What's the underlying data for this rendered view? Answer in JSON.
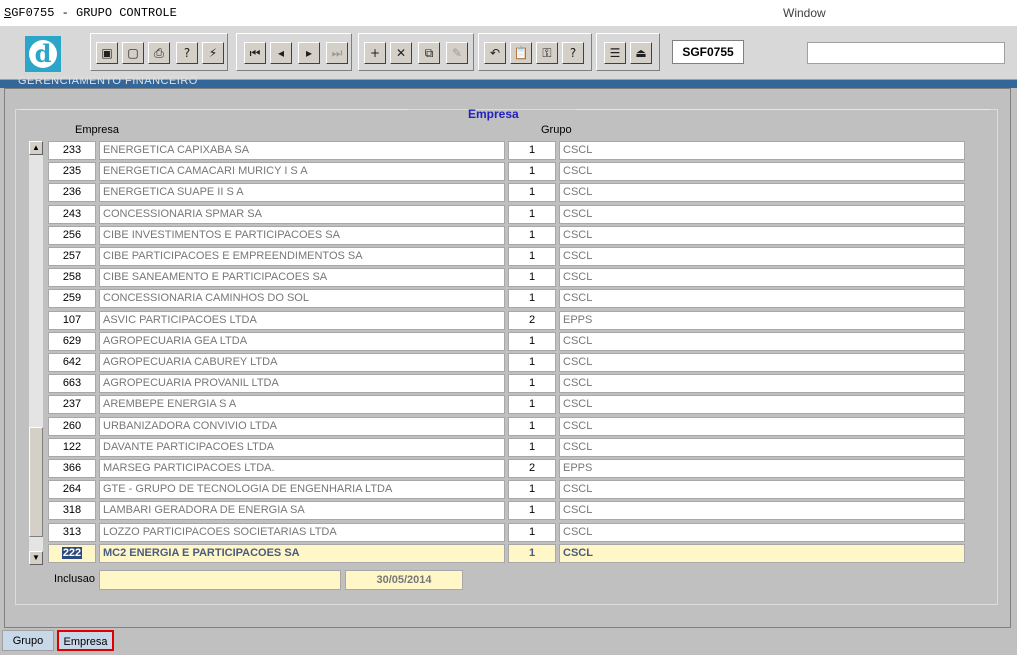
{
  "window": {
    "title_prefix": "S",
    "title_rest": "GF0755 - GRUPO CONTROLE",
    "menu": "Window"
  },
  "toolbar": {
    "form_name": "SGF0755",
    "buttons": [
      {
        "name": "save-icon",
        "glyph": "▣"
      },
      {
        "name": "window-icon",
        "glyph": "▢"
      },
      {
        "name": "print-icon",
        "glyph": "⎙"
      },
      {
        "name": "query-icon",
        "glyph": "?"
      },
      {
        "name": "execute-query-icon",
        "glyph": "⚡"
      },
      {
        "name": "first-record-icon",
        "glyph": "⏮"
      },
      {
        "name": "prev-record-icon",
        "glyph": "◂"
      },
      {
        "name": "next-record-icon",
        "glyph": "▸"
      },
      {
        "name": "last-record-icon",
        "glyph": "⏭"
      },
      {
        "name": "insert-record-icon",
        "glyph": "+"
      },
      {
        "name": "delete-record-icon",
        "glyph": "✕"
      },
      {
        "name": "duplicate-record-icon",
        "glyph": "⧉"
      },
      {
        "name": "edit-icon",
        "glyph": "✎"
      },
      {
        "name": "undo-icon",
        "glyph": "↶"
      },
      {
        "name": "clipboard-icon",
        "glyph": "📋"
      },
      {
        "name": "key-icon",
        "glyph": "⚿"
      },
      {
        "name": "help-icon",
        "glyph": "?"
      },
      {
        "name": "menu-icon",
        "glyph": "☰"
      },
      {
        "name": "exit-icon",
        "glyph": "⏏"
      }
    ]
  },
  "section_title": "Empresa",
  "headers": {
    "empresa": "Empresa",
    "grupo": "Grupo"
  },
  "rows": [
    {
      "code": "233",
      "name": "ENERGETICA CAPIXABA SA",
      "grp": "1",
      "gname": "CSCL"
    },
    {
      "code": "235",
      "name": "ENERGETICA CAMACARI MURICY I S A",
      "grp": "1",
      "gname": "CSCL"
    },
    {
      "code": "236",
      "name": "ENERGETICA SUAPE II S A",
      "grp": "1",
      "gname": "CSCL"
    },
    {
      "code": "243",
      "name": "CONCESSIONARIA SPMAR SA",
      "grp": "1",
      "gname": "CSCL"
    },
    {
      "code": "256",
      "name": "CIBE INVESTIMENTOS E PARTICIPACOES SA",
      "grp": "1",
      "gname": "CSCL"
    },
    {
      "code": "257",
      "name": "CIBE PARTICIPACOES E EMPREENDIMENTOS SA",
      "grp": "1",
      "gname": "CSCL"
    },
    {
      "code": "258",
      "name": "CIBE SANEAMENTO E PARTICIPACOES SA",
      "grp": "1",
      "gname": "CSCL"
    },
    {
      "code": "259",
      "name": "CONCESSIONARIA CAMINHOS DO SOL",
      "grp": "1",
      "gname": "CSCL"
    },
    {
      "code": "107",
      "name": "ASVIC PARTICIPACOES LTDA",
      "grp": "2",
      "gname": "EPPS"
    },
    {
      "code": "629",
      "name": "AGROPECUARIA GEA LTDA",
      "grp": "1",
      "gname": "CSCL"
    },
    {
      "code": "642",
      "name": "AGROPECUARIA CABUREY LTDA",
      "grp": "1",
      "gname": "CSCL"
    },
    {
      "code": "663",
      "name": "AGROPECUARIA PROVANIL LTDA",
      "grp": "1",
      "gname": "CSCL"
    },
    {
      "code": "237",
      "name": "AREMBEPE ENERGIA S A",
      "grp": "1",
      "gname": "CSCL"
    },
    {
      "code": "260",
      "name": "URBANIZADORA CONVIVIO LTDA",
      "grp": "1",
      "gname": "CSCL"
    },
    {
      "code": "122",
      "name": "DAVANTE PARTICIPACOES LTDA",
      "grp": "1",
      "gname": "CSCL"
    },
    {
      "code": "366",
      "name": "MARSEG PARTICIPACOES LTDA.",
      "grp": "2",
      "gname": "EPPS"
    },
    {
      "code": "264",
      "name": "GTE - GRUPO DE TECNOLOGIA DE ENGENHARIA LTDA",
      "grp": "1",
      "gname": "CSCL"
    },
    {
      "code": "318",
      "name": "LAMBARI GERADORA DE ENERGIA SA",
      "grp": "1",
      "gname": "CSCL"
    },
    {
      "code": "313",
      "name": "LOZZO PARTICIPACOES SOCIETARIAS LTDA",
      "grp": "1",
      "gname": "CSCL"
    },
    {
      "code": "222",
      "name": "MC2 ENERGIA E PARTICIPACOES SA",
      "grp": "1",
      "gname": "CSCL"
    }
  ],
  "inclusao": {
    "label": "Inclusao",
    "user": "",
    "date": "30/05/2014"
  },
  "tabs": {
    "grupo": "Grupo",
    "empresa": "Empresa"
  }
}
